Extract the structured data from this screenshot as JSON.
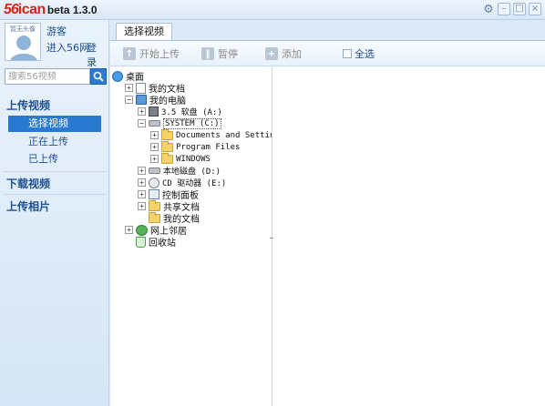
{
  "app": {
    "logo_56": "56",
    "logo_ican": "ican",
    "version": "beta 1.3.0"
  },
  "window_controls": [
    {
      "name": "settings",
      "icon": "gear-icon",
      "glyph": "⚙"
    },
    {
      "name": "minimize",
      "icon": "minimize-icon",
      "glyph": "–"
    },
    {
      "name": "maximize",
      "icon": "maximize-icon",
      "glyph": "□"
    },
    {
      "name": "close",
      "icon": "close-icon",
      "glyph": "×"
    }
  ],
  "profile": {
    "avatar_caption": "暂无头像",
    "user_name": "游客",
    "home_link": "进入56网",
    "login_link": "登录"
  },
  "search": {
    "placeholder": "搜索56视频",
    "icon": "search-icon"
  },
  "nav": {
    "upload_video": "上传视频",
    "upload_items": [
      "选择视频",
      "正在上传",
      "已上传"
    ],
    "active_upload_index": 0,
    "download_video": "下载视频",
    "upload_photos": "上传相片"
  },
  "tabs": [
    {
      "label": "选择视频",
      "active": true
    }
  ],
  "toolbar": {
    "start_upload": "开始上传",
    "pause": "暂停",
    "add": "添加",
    "select_all": "全选"
  },
  "tree": [
    {
      "label": "桌面",
      "icon": "desktop-icon",
      "toggle": ""
    },
    {
      "label": "我的文档",
      "icon": "my-documents-icon",
      "toggle": "+"
    },
    {
      "label": "我的电脑",
      "icon": "my-computer-icon",
      "toggle": "−"
    },
    {
      "label": "3.5 软盘 (A:)",
      "icon": "floppy-icon",
      "toggle": "+"
    },
    {
      "label": "SYSTEM (C:)",
      "icon": "hard-drive-icon",
      "toggle": "−",
      "selected": true
    },
    {
      "label": "Documents and Settings",
      "icon": "folder-icon",
      "toggle": "+"
    },
    {
      "label": "Program Files",
      "icon": "folder-icon",
      "toggle": "+"
    },
    {
      "label": "WINDOWS",
      "icon": "folder-icon",
      "toggle": "+"
    },
    {
      "label": "本地磁盘 (D:)",
      "icon": "hard-drive-icon",
      "toggle": "+"
    },
    {
      "label": "CD 驱动器 (E:)",
      "icon": "cd-drive-icon",
      "toggle": "+"
    },
    {
      "label": "控制面板",
      "icon": "control-panel-icon",
      "toggle": "+"
    },
    {
      "label": "共享文档",
      "icon": "folder-icon",
      "toggle": "+"
    },
    {
      "label": "我的文档",
      "icon": "folder-icon",
      "toggle": ""
    },
    {
      "label": "网上邻居",
      "icon": "network-icon",
      "toggle": "+"
    },
    {
      "label": "回收站",
      "icon": "recycle-bin-icon",
      "toggle": ""
    }
  ]
}
